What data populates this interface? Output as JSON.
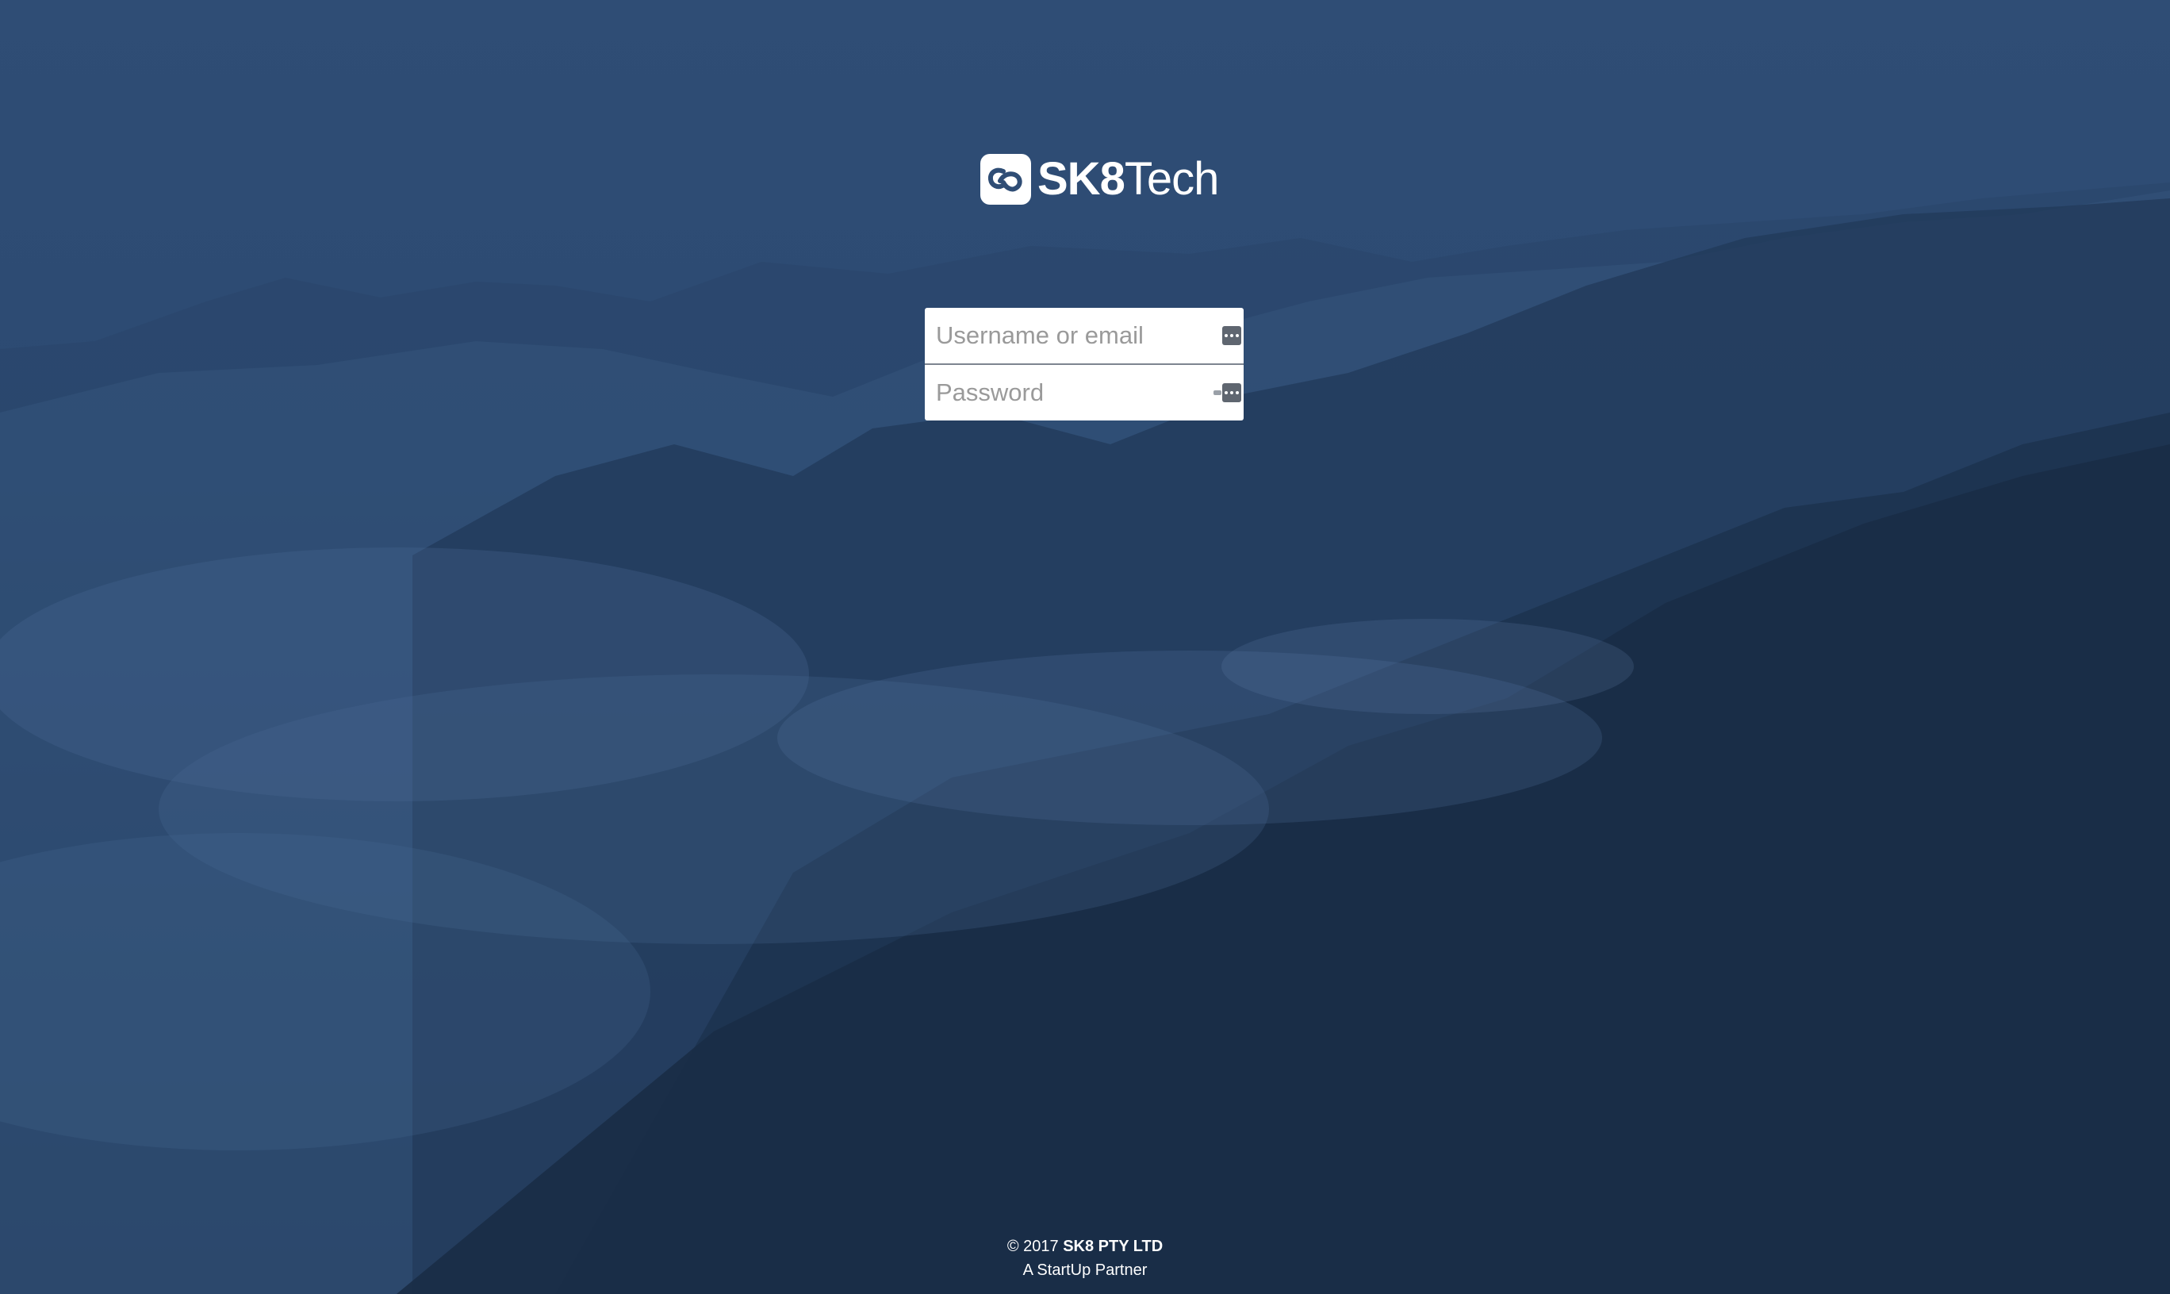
{
  "brand": {
    "name_bold": "SK8",
    "name_light": "Tech",
    "logo_icon": "sk8-link-icon"
  },
  "login": {
    "username_placeholder": "Username or email",
    "password_placeholder": "Password",
    "username_value": "",
    "password_value": "",
    "pw_manager_icon": "password-manager-icon"
  },
  "footer": {
    "copyright_prefix": "© 2017",
    "company": "SK8 PTY LTD",
    "tagline": "A StartUp Partner"
  },
  "colors": {
    "background_top": "#2f4d75",
    "background_bottom": "#1f3655",
    "text": "#ffffff"
  }
}
